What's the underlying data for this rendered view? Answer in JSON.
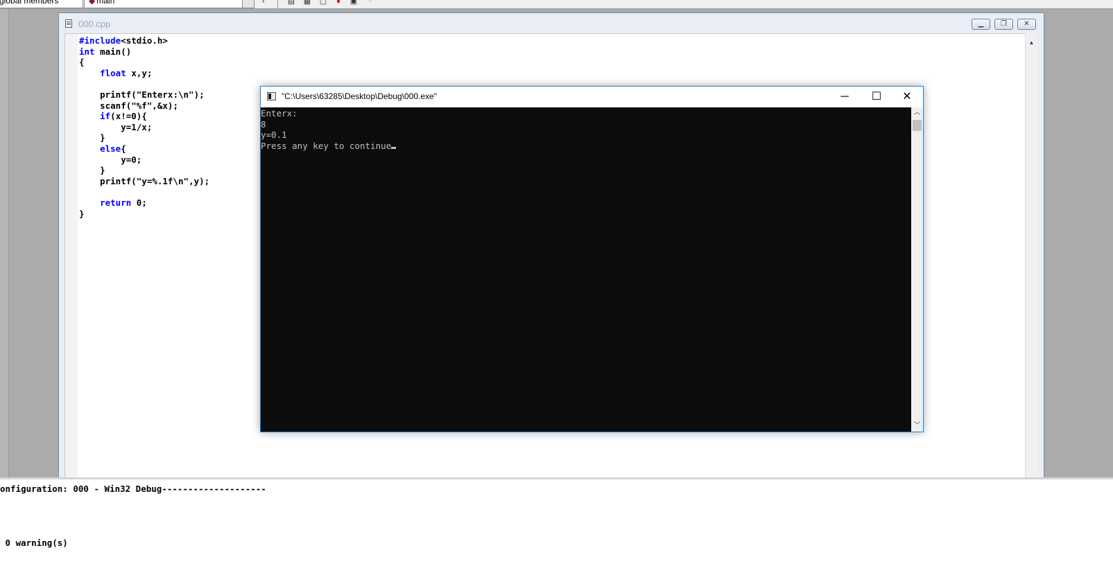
{
  "toolbar": {
    "scope_combo": "global members",
    "function_combo": "main"
  },
  "editor": {
    "title": "000.cpp",
    "code": [
      "#include<stdio.h>",
      "int main()",
      "{",
      "    float x,y;",
      "",
      "    printf(\"Enterx:\\n\");",
      "    scanf(\"%f\",&x);",
      "    if(x!=0){",
      "        y=1/x;",
      "    }",
      "    else{",
      "        y=0;",
      "    }",
      "    printf(\"y=%.1f\\n\",y);",
      "",
      "    return 0;",
      "}"
    ],
    "mdi_buttons": [
      "minimize-icon",
      "restore-icon",
      "close-icon"
    ]
  },
  "console": {
    "title": "\"C:\\Users\\63285\\Desktop\\Debug\\000.exe\"",
    "lines": [
      "Enterx:",
      "8",
      "y=0.1",
      "Press any key to continue"
    ],
    "background": "#0c0c0c",
    "foreground": "#c0c0c0",
    "window_buttons": [
      "minimize-icon",
      "maximize-icon",
      "close-icon"
    ]
  },
  "output": {
    "config_line": "onfiguration: 000 - Win32 Debug--------------------",
    "warnings_line": " 0 warning(s)"
  },
  "colors": {
    "keyword": "#0000ff",
    "console_border": "#1883d7",
    "workspace": "#ababab"
  }
}
